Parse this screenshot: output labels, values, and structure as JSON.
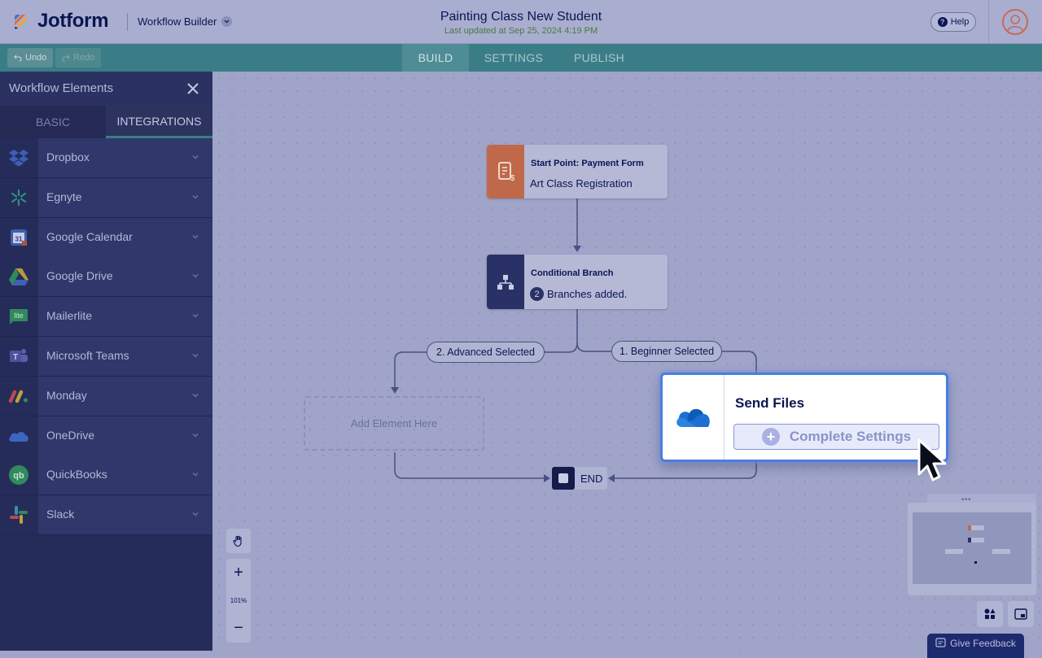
{
  "header": {
    "brand": "Jotform",
    "builder_label": "Workflow Builder",
    "title": "Painting Class New Student",
    "last_updated": "Last updated at Sep 25, 2024 4:19 PM",
    "help_label": "Help"
  },
  "toolbar": {
    "undo_label": "Undo",
    "redo_label": "Redo",
    "tabs": [
      {
        "label": "BUILD",
        "active": true
      },
      {
        "label": "SETTINGS",
        "active": false
      },
      {
        "label": "PUBLISH",
        "active": false
      }
    ]
  },
  "sidebar": {
    "title": "Workflow Elements",
    "tabs": [
      {
        "label": "BASIC",
        "active": false
      },
      {
        "label": "INTEGRATIONS",
        "active": true
      }
    ],
    "items": [
      {
        "label": "Dropbox",
        "icon": "dropbox-icon"
      },
      {
        "label": "Egnyte",
        "icon": "egnyte-icon"
      },
      {
        "label": "Google Calendar",
        "icon": "google-calendar-icon"
      },
      {
        "label": "Google Drive",
        "icon": "google-drive-icon"
      },
      {
        "label": "Mailerlite",
        "icon": "mailerlite-icon"
      },
      {
        "label": "Microsoft Teams",
        "icon": "microsoft-teams-icon"
      },
      {
        "label": "Monday",
        "icon": "monday-icon"
      },
      {
        "label": "OneDrive",
        "icon": "onedrive-icon"
      },
      {
        "label": "QuickBooks",
        "icon": "quickbooks-icon"
      },
      {
        "label": "Slack",
        "icon": "slack-icon"
      }
    ]
  },
  "workflow": {
    "start_node": {
      "title": "Start Point: Payment Form",
      "subtitle": "Art Class Registration"
    },
    "branch_node": {
      "title": "Conditional Branch",
      "count": "2",
      "subtitle": "Branches added."
    },
    "branch_labels": [
      "2. Advanced Selected",
      "1. Beginner Selected"
    ],
    "add_element": "Add Element Here",
    "end_label": "END",
    "send_files": {
      "title": "Send Files",
      "button_label": "Complete Settings"
    }
  },
  "zoom": {
    "plus": "+",
    "level": "101%",
    "minus": "−"
  },
  "feedback_label": "Give Feedback",
  "colors": {
    "accent_teal": "#3b7d86",
    "start_node": "#c0684a",
    "branch_node": "#2a3166",
    "selection_blue": "#4a7ee0",
    "brand_navy": "#0a1551"
  }
}
